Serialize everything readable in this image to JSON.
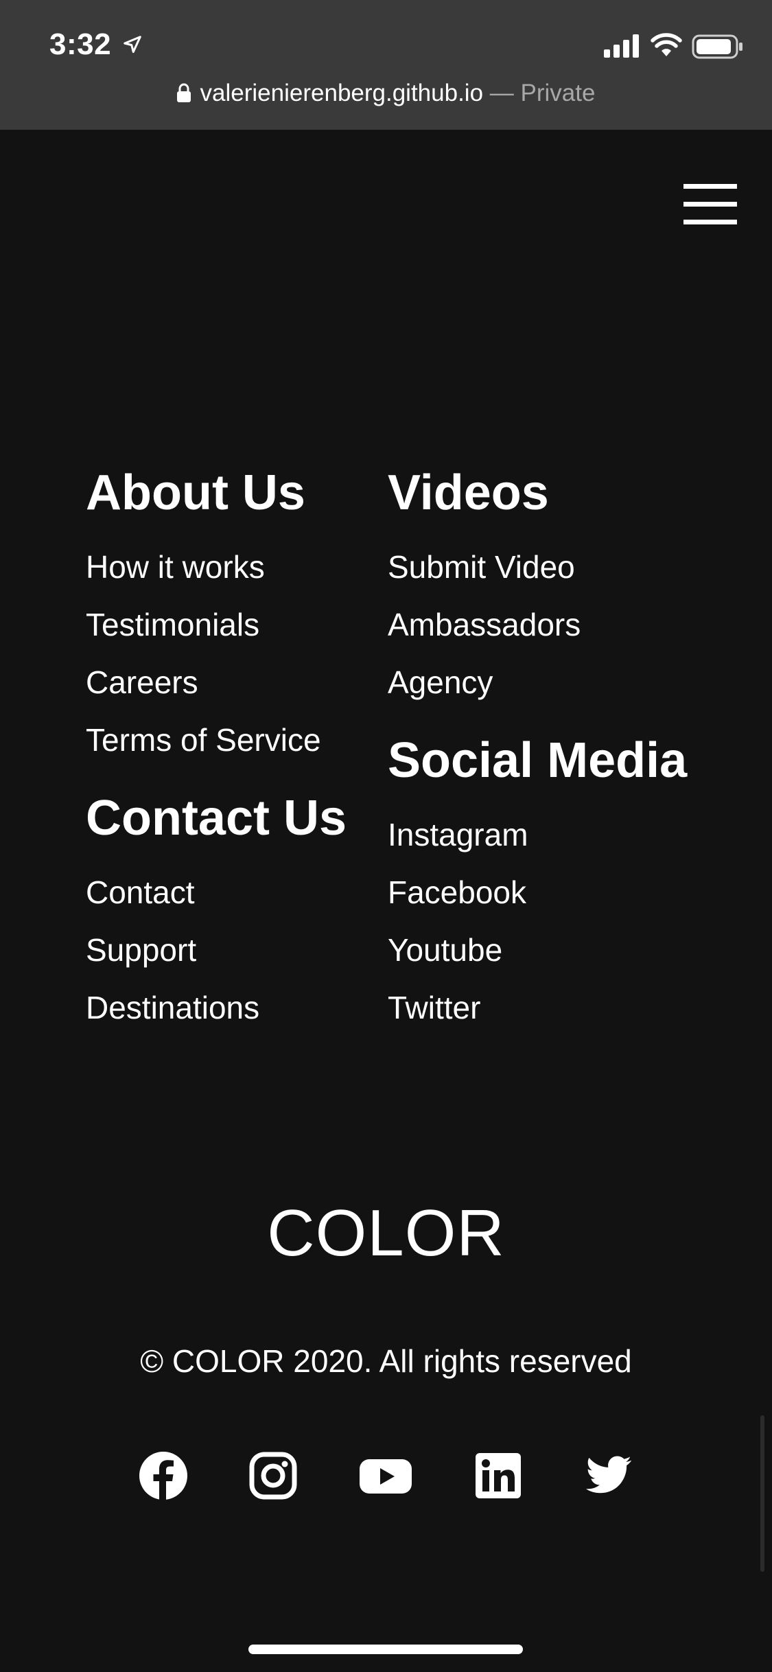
{
  "status_bar": {
    "time": "3:32",
    "icons": [
      "location-arrow-icon",
      "cellular-signal-icon",
      "wifi-icon",
      "battery-icon"
    ]
  },
  "browser": {
    "url": "valerienierenberg.github.io",
    "separator": " — ",
    "mode": "Private"
  },
  "header": {
    "menu_icon": "hamburger-menu-icon"
  },
  "footer": {
    "about": {
      "heading": "About Us",
      "links": [
        "How it works",
        "Testimonials",
        "Careers",
        "Terms of Service"
      ]
    },
    "contact": {
      "heading": "Contact Us",
      "links": [
        "Contact",
        "Support",
        "Destinations"
      ]
    },
    "videos": {
      "heading": "Videos",
      "links": [
        "Submit Video",
        "Ambassadors",
        "Agency"
      ]
    },
    "social": {
      "heading": "Social Media",
      "links": [
        "Instagram",
        "Facebook",
        "Youtube",
        "Twitter"
      ]
    },
    "brand": "COLOR",
    "copyright": "© COLOR 2020. All rights reserved",
    "social_icons": [
      "facebook-icon",
      "instagram-icon",
      "youtube-icon",
      "linkedin-icon",
      "twitter-icon"
    ]
  },
  "colors": {
    "background": "#121212",
    "chrome": "#3a3a3a",
    "text": "#ffffff",
    "muted": "#a8a8a8"
  }
}
